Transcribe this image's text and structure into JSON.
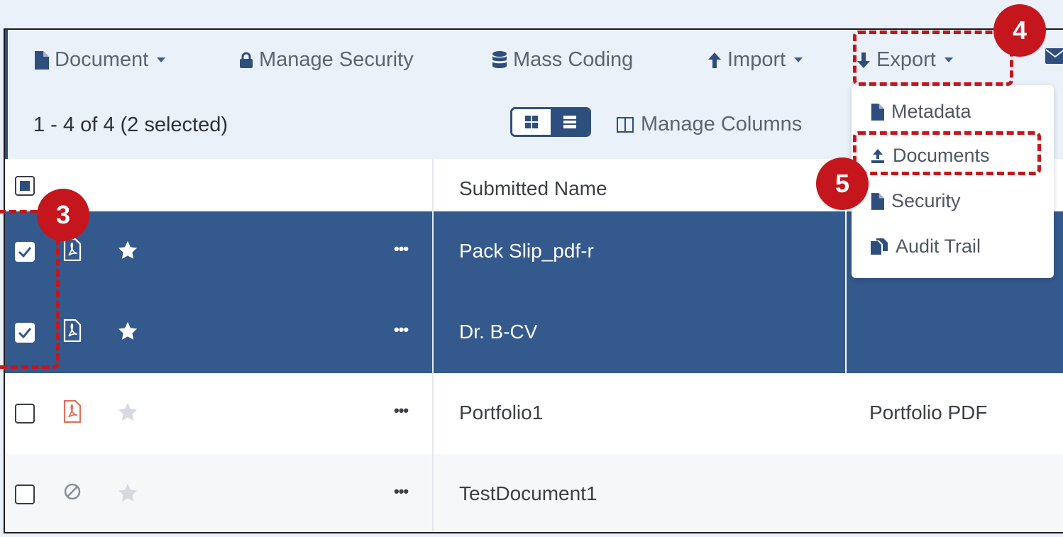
{
  "toolbar": {
    "document_label": "Document",
    "manage_security_label": "Manage Security",
    "mass_coding_label": "Mass Coding",
    "import_label": "Import",
    "export_label": "Export"
  },
  "subbar": {
    "count_text": "1 - 4 of 4 (2 selected)",
    "manage_columns_label": "Manage Columns"
  },
  "table": {
    "header_submitted_name": "Submitted Name",
    "rows": [
      {
        "name": "Pack Slip_pdf-r",
        "type": "",
        "selected": true,
        "icon": "pdf-icon",
        "starred": true
      },
      {
        "name": "Dr. B-CV",
        "type": "",
        "selected": true,
        "icon": "pdf-icon",
        "starred": true
      },
      {
        "name": "Portfolio1",
        "type": "Portfolio PDF",
        "selected": false,
        "icon": "pdf-icon",
        "starred": false
      },
      {
        "name": "TestDocument1",
        "type": "",
        "selected": false,
        "icon": "blocked-icon",
        "starred": false
      }
    ]
  },
  "export_menu": {
    "items": [
      "Metadata",
      "Documents",
      "Security",
      "Audit Trail"
    ]
  },
  "callouts": {
    "badge_3": "3",
    "badge_4": "4",
    "badge_5": "5"
  },
  "colors": {
    "accent": "#2e4f7d",
    "selected_row": "#34598d",
    "callout_red": "#c5161d",
    "pdf_red": "#e0705a"
  }
}
